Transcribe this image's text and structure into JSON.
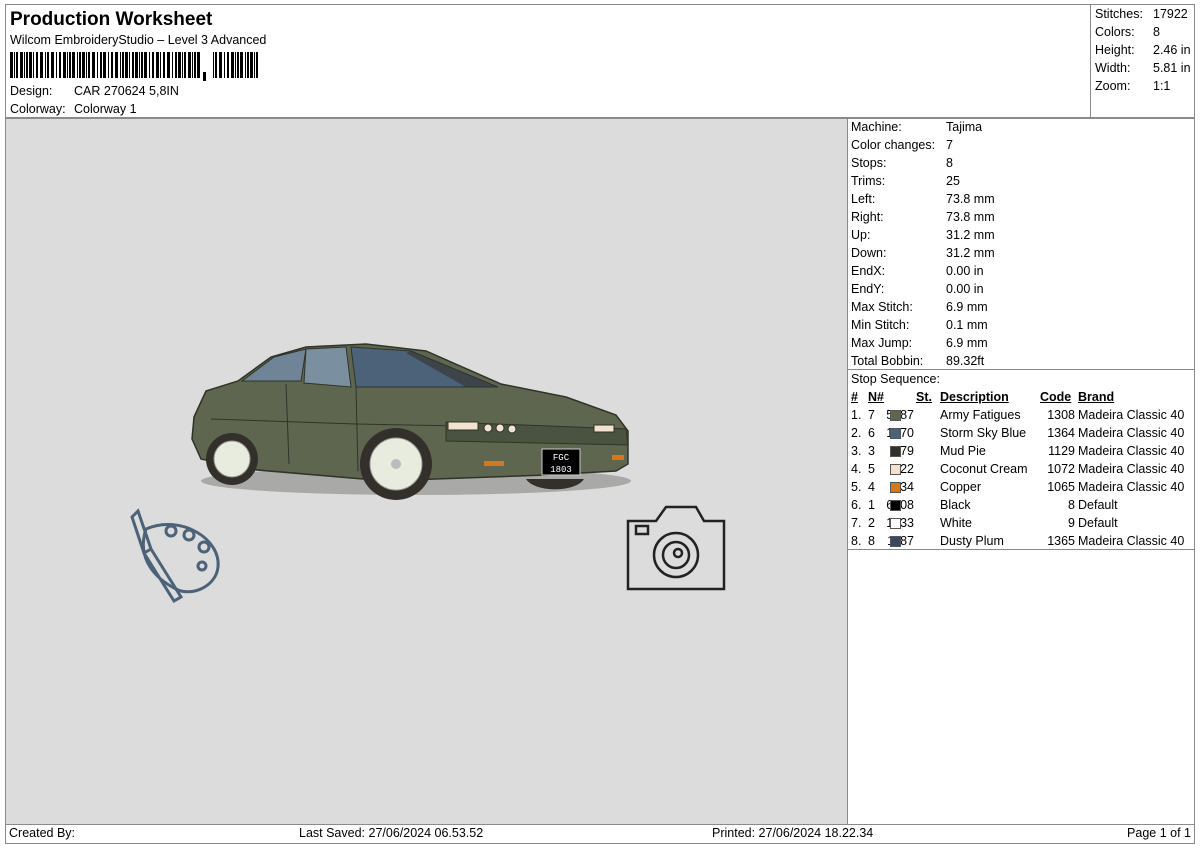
{
  "header": {
    "title": "Production Worksheet",
    "subtitle": "Wilcom EmbroideryStudio – Level 3 Advanced",
    "design_label": "Design:",
    "design_value": "CAR 270624 5,8IN",
    "colorway_label": "Colorway:",
    "colorway_value": "Colorway 1"
  },
  "stats": [
    {
      "k": "Stitches:",
      "v": "17922"
    },
    {
      "k": "Colors:",
      "v": "8"
    },
    {
      "k": "Height:",
      "v": "2.46 in"
    },
    {
      "k": "Width:",
      "v": "5.81 in"
    },
    {
      "k": "Zoom:",
      "v": "1:1"
    }
  ],
  "info": [
    {
      "k": "Machine:",
      "v": "Tajima"
    },
    {
      "k": "Color changes:",
      "v": "7"
    },
    {
      "k": "Stops:",
      "v": "8"
    },
    {
      "k": "Trims:",
      "v": "25"
    },
    {
      "k": "Left:",
      "v": "73.8 mm"
    },
    {
      "k": "Right:",
      "v": "73.8 mm"
    },
    {
      "k": "Up:",
      "v": "31.2 mm"
    },
    {
      "k": "Down:",
      "v": "31.2 mm"
    },
    {
      "k": "EndX:",
      "v": "0.00 in"
    },
    {
      "k": "EndY:",
      "v": "0.00 in"
    },
    {
      "k": "Max Stitch:",
      "v": "6.9 mm"
    },
    {
      "k": "Min Stitch:",
      "v": "0.1 mm"
    },
    {
      "k": "Max Jump:",
      "v": "6.9 mm"
    },
    {
      "k": "Total Bobbin:",
      "v": "89.32ft"
    }
  ],
  "sequence": {
    "heading": "Stop Sequence:",
    "columns": {
      "num": "#",
      "n": "N#",
      "st": "St.",
      "desc": "Description",
      "code": "Code",
      "brand": "Brand"
    },
    "rows": [
      {
        "num": "1.",
        "n": "7",
        "color": "#5e6650",
        "st": "5187",
        "desc": "Army Fatigues",
        "code": "1308",
        "brand": "Madeira Classic 40"
      },
      {
        "num": "2.",
        "n": "6",
        "color": "#4b6278",
        "st": "1370",
        "desc": "Storm Sky Blue",
        "code": "1364",
        "brand": "Madeira Classic 40"
      },
      {
        "num": "3.",
        "n": "3",
        "color": "#33302b",
        "st": "679",
        "desc": "Mud Pie",
        "code": "1129",
        "brand": "Madeira Classic 40"
      },
      {
        "num": "4.",
        "n": "5",
        "color": "#f3e2cf",
        "st": "822",
        "desc": "Coconut Cream",
        "code": "1072",
        "brand": "Madeira Classic 40"
      },
      {
        "num": "5.",
        "n": "4",
        "color": "#d9761a",
        "st": "134",
        "desc": "Copper",
        "code": "1065",
        "brand": "Madeira Classic 40"
      },
      {
        "num": "6.",
        "n": "1",
        "color": "#000000",
        "st": "6608",
        "desc": "Black",
        "code": "8",
        "brand": "Default"
      },
      {
        "num": "7.",
        "n": "2",
        "color": "#ffffff",
        "st": "1933",
        "desc": "White",
        "code": "9",
        "brand": "Default"
      },
      {
        "num": "8.",
        "n": "8",
        "color": "#3a4a5e",
        "st": "1187",
        "desc": "Dusty Plum",
        "code": "1365",
        "brand": "Madeira Classic 40"
      }
    ]
  },
  "plate": {
    "line1": "FGC",
    "line2": "1803"
  },
  "footer": {
    "created": "Created By:",
    "saved": "Last Saved: 27/06/2024 06.53.52",
    "printed": "Printed: 27/06/2024 18.22.34",
    "page": "Page 1 of 1"
  }
}
